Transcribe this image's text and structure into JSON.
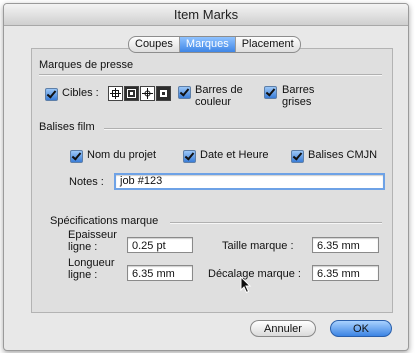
{
  "window": {
    "title": "Item Marks"
  },
  "tabs": [
    {
      "label": "Coupes"
    },
    {
      "label": "Marques",
      "active": true
    },
    {
      "label": "Placement"
    }
  ],
  "marques_presse": {
    "title": "Marques de presse",
    "cibles_label": "Cibles :",
    "cibles_checked": true,
    "cible_icons": [
      "crosshair-target-icon",
      "square-target-icon",
      "crosshair-small-target-icon",
      "square-alt-target-icon"
    ],
    "barres_couleur_label_1": "Barres de",
    "barres_couleur_label_2": "couleur",
    "barres_couleur_checked": true,
    "barres_grises_label_1": "Barres",
    "barres_grises_label_2": "grises",
    "barres_grises_checked": true
  },
  "balises_film": {
    "title": "Balises film",
    "nom_projet_label": "Nom du projet",
    "nom_projet_checked": true,
    "date_heure_label": "Date et Heure",
    "date_heure_checked": true,
    "balises_cmjn_label": "Balises CMJN",
    "balises_cmjn_checked": true,
    "notes_label": "Notes :",
    "notes_value": "job #123"
  },
  "specifications": {
    "title": "Spécifications marque",
    "epaisseur_label_1": "Epaisseur",
    "epaisseur_label_2": "ligne :",
    "epaisseur_value": "0.25 pt",
    "longueur_label_1": "Longueur",
    "longueur_label_2": "ligne :",
    "longueur_value": "6.35 mm",
    "taille_label": "Taille marque :",
    "taille_value": "6.35 mm",
    "decalage_label": "Décalage marque :",
    "decalage_value": "6.35 mm"
  },
  "buttons": {
    "cancel": "Annuler",
    "ok": "OK"
  },
  "colors": {
    "accent": "#3c84e3",
    "window_bg": "#e8e8e8"
  }
}
